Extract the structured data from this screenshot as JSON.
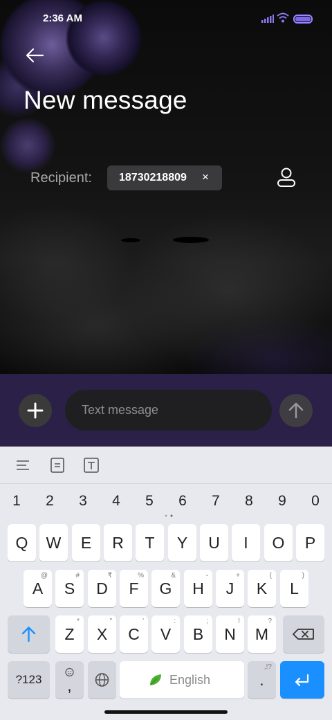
{
  "status_bar": {
    "time": "2:36 AM"
  },
  "header": {
    "title": "New message"
  },
  "recipient": {
    "label": "Recipient:",
    "number": "18730218809",
    "remove_glyph": "×"
  },
  "compose": {
    "placeholder": "Text message"
  },
  "keyboard": {
    "number_row": [
      "1",
      "2",
      "3",
      "4",
      "5",
      "6",
      "7",
      "8",
      "9",
      "0"
    ],
    "row1": [
      {
        "key": "Q",
        "alt": ""
      },
      {
        "key": "W",
        "alt": ""
      },
      {
        "key": "E",
        "alt": ""
      },
      {
        "key": "R",
        "alt": ""
      },
      {
        "key": "T",
        "alt": ""
      },
      {
        "key": "Y",
        "alt": ""
      },
      {
        "key": "U",
        "alt": ""
      },
      {
        "key": "I",
        "alt": ""
      },
      {
        "key": "O",
        "alt": ""
      },
      {
        "key": "P",
        "alt": ""
      }
    ],
    "row2": [
      {
        "key": "A",
        "alt": "@"
      },
      {
        "key": "S",
        "alt": "#"
      },
      {
        "key": "D",
        "alt": "₹"
      },
      {
        "key": "F",
        "alt": "%"
      },
      {
        "key": "G",
        "alt": "&"
      },
      {
        "key": "H",
        "alt": "-"
      },
      {
        "key": "J",
        "alt": "+"
      },
      {
        "key": "K",
        "alt": "("
      },
      {
        "key": "L",
        "alt": ")"
      }
    ],
    "row3": [
      {
        "key": "Z",
        "alt": "*"
      },
      {
        "key": "X",
        "alt": "\""
      },
      {
        "key": "C",
        "alt": "'"
      },
      {
        "key": "V",
        "alt": ":"
      },
      {
        "key": "B",
        "alt": ";"
      },
      {
        "key": "N",
        "alt": "!"
      },
      {
        "key": "M",
        "alt": "?"
      }
    ],
    "symbols_key": "?123",
    "emoji_comma_key": ",",
    "space_label": "English",
    "period_key": ".",
    "period_alt": ",!?"
  },
  "colors": {
    "accent": "#1a8fff",
    "compose_bar": "#2b2047",
    "battery": "#7b66f0"
  },
  "icons": [
    "back-arrow-icon",
    "contact-icon",
    "plus-icon",
    "send-arrow-icon",
    "signal-icon",
    "wifi-icon",
    "battery-icon",
    "shift-arrow-icon",
    "backspace-icon",
    "globe-icon",
    "emoji-icon",
    "leaf-icon",
    "enter-icon"
  ]
}
